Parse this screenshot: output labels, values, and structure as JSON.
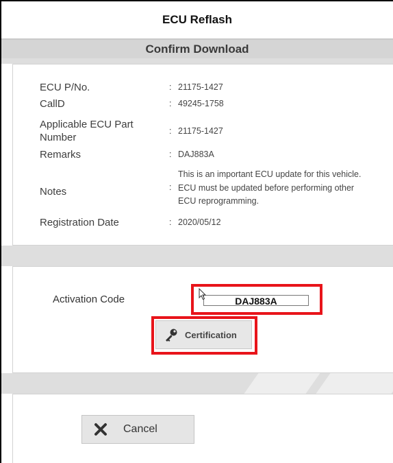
{
  "window": {
    "title": "ECU Reflash",
    "subtitle": "Confirm Download"
  },
  "details": [
    {
      "label": "ECU P/No.",
      "value": "21175-1427"
    },
    {
      "label": "CallD",
      "value": "49245-1758"
    },
    {
      "label": "Applicable ECU Part Number",
      "value": "21175-1427"
    },
    {
      "label": "Remarks",
      "value": "DAJ883A"
    },
    {
      "label": "Notes",
      "value": "This is an important ECU update for this vehicle. ECU must be updated before performing other ECU reprogramming."
    },
    {
      "label": "Registration Date",
      "value": "2020/05/12"
    }
  ],
  "separator": ":",
  "activation": {
    "label": "Activation Code",
    "value": "DAJ883A"
  },
  "buttons": {
    "certification": {
      "label": "Certification",
      "icon": "key-icon"
    },
    "cancel": {
      "label": "Cancel",
      "icon": "close-icon"
    }
  },
  "colors": {
    "highlight": "#e8141a",
    "header_band": "#d5d5d5",
    "button_bg": "#e7e7e7"
  }
}
